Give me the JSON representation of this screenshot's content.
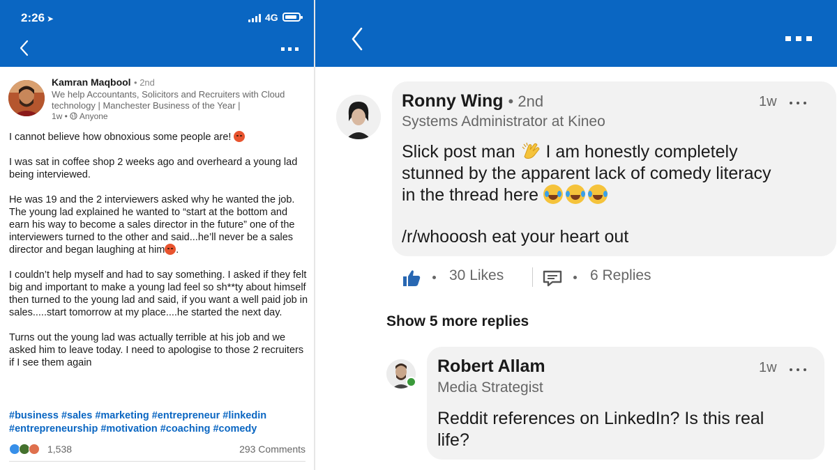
{
  "status_bar": {
    "time": "2:26",
    "network": "4G"
  },
  "left_post": {
    "author_name": "Kamran Maqbool",
    "author_degree": "• 2nd",
    "author_headline": "We help Accountants, Solicitors and Recruiters with Cloud technology | Manchester Business of the Year |",
    "post_age": "1w",
    "post_visibility": "Anyone",
    "paragraphs": {
      "p1": "I cannot believe how obnoxious some people are!",
      "p2": "I was sat in coffee shop 2 weeks ago and overheard a young lad being interviewed.",
      "p3": "He was 19 and the 2 interviewers asked why he wanted the job. The young lad explained he wanted to “start at the bottom and earn his way to become a sales director in the future” one of the interviewers turned to the other and said...he’ll never be a sales director and began laughing at him",
      "p3_end": ".",
      "p4": "I couldn’t help myself and had to say something. I asked if they felt big and important to make a young lad feel so sh**ty about himself then turned to the young lad and said, if you want a well paid job in sales.....start tomorrow at my place....he started the next day.",
      "p5": "Turns out the young lad was actually terrible at his job and we asked him to leave today. I need to apologise to those 2 recruiters if I see them again"
    },
    "hashtags": "#business #sales #marketing #entrepreneur #linkedin #entrepreneurship #motivation #coaching #comedy",
    "reaction_count": "1,538",
    "comment_count": "293 Comments"
  },
  "comments": {
    "c1": {
      "name": "Ronny Wing",
      "degree": "• 2nd",
      "headline": "Systems Administrator at Kineo",
      "age": "1w",
      "line1": "Slick post man",
      "line1b": "I am honestly completely",
      "line2": "stunned by the apparent lack of comedy literacy",
      "line3": "in the thread here",
      "line4": "/r/whooosh eat your heart out",
      "likes_label": "30 Likes",
      "replies_label": "6 Replies"
    },
    "show_more": "Show 5 more replies",
    "c2": {
      "name": "Robert Allam",
      "headline": "Media Strategist",
      "age": "1w",
      "line1": "Reddit references on LinkedIn? Is this real",
      "line2": "life?"
    }
  },
  "colors": {
    "brand_blue": "#0a66c2",
    "bubble_bg": "#f2f2f2",
    "online_green": "#3a9a3a"
  },
  "icons": [
    "location-arrow-icon",
    "signal-icon",
    "battery-icon",
    "back-chevron-icon",
    "more-dots-icon",
    "globe-icon",
    "angry-emoji-icon",
    "like-reaction-icon",
    "celebrate-reaction-icon",
    "love-reaction-icon",
    "clap-emoji-icon",
    "crying-laughing-emoji-icon",
    "tears-of-joy-emoji-icon",
    "thumbs-up-icon",
    "reply-icon"
  ]
}
